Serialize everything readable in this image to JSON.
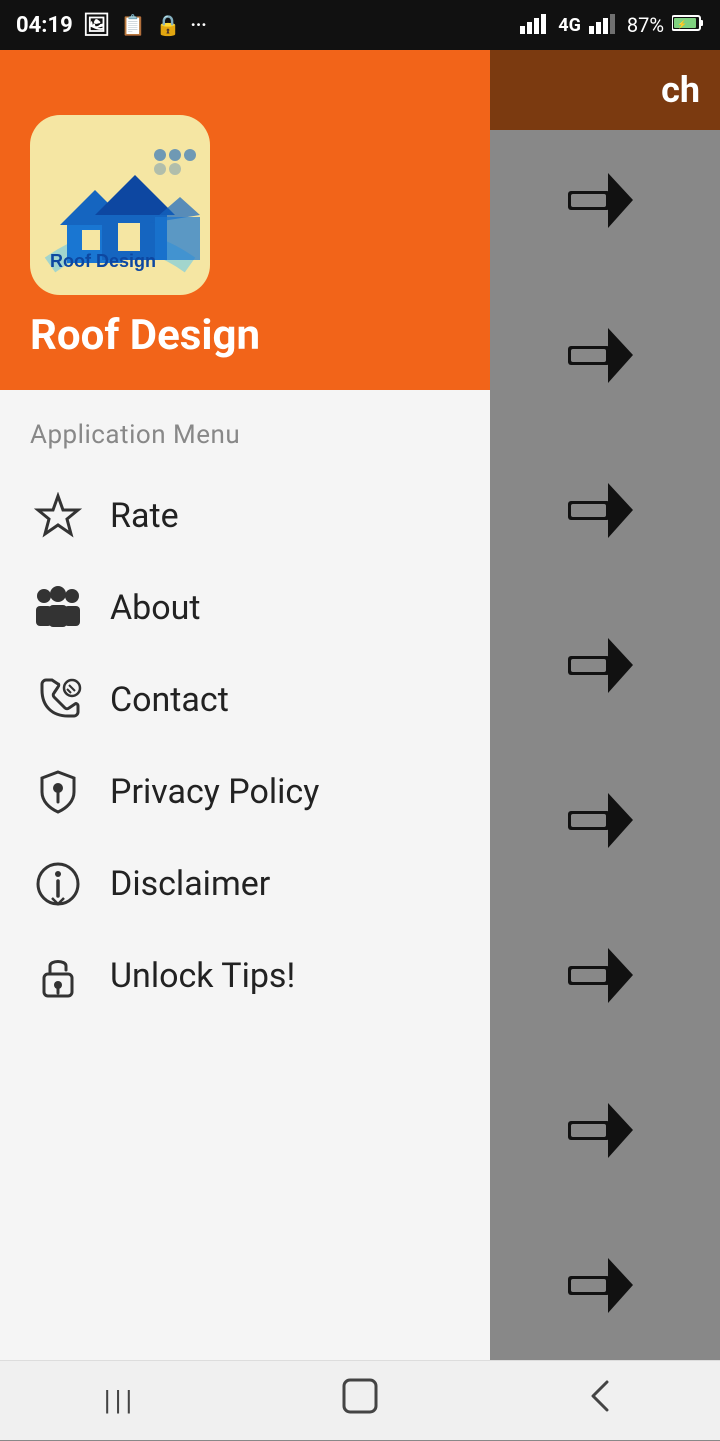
{
  "statusBar": {
    "time": "04:19",
    "battery": "87%"
  },
  "rightHeader": {
    "text": "ch"
  },
  "drawer": {
    "appTitle": "Roof Design",
    "menuSectionLabel": "Application Menu",
    "menuItems": [
      {
        "id": "rate",
        "label": "Rate",
        "icon": "☆"
      },
      {
        "id": "about",
        "label": "About",
        "icon": "👥"
      },
      {
        "id": "contact",
        "label": "Contact",
        "icon": "📞"
      },
      {
        "id": "privacy",
        "label": "Privacy Policy",
        "icon": "🛡"
      },
      {
        "id": "disclaimer",
        "label": "Disclaimer",
        "icon": "ℹ"
      },
      {
        "id": "unlock",
        "label": "Unlock Tips!",
        "icon": "🔒"
      }
    ]
  },
  "navBar": {
    "recents": "|||",
    "home": "○",
    "back": "‹"
  },
  "arrows": [
    "➦",
    "➦",
    "➦",
    "➦",
    "➦",
    "➦",
    "➦",
    "➦"
  ]
}
